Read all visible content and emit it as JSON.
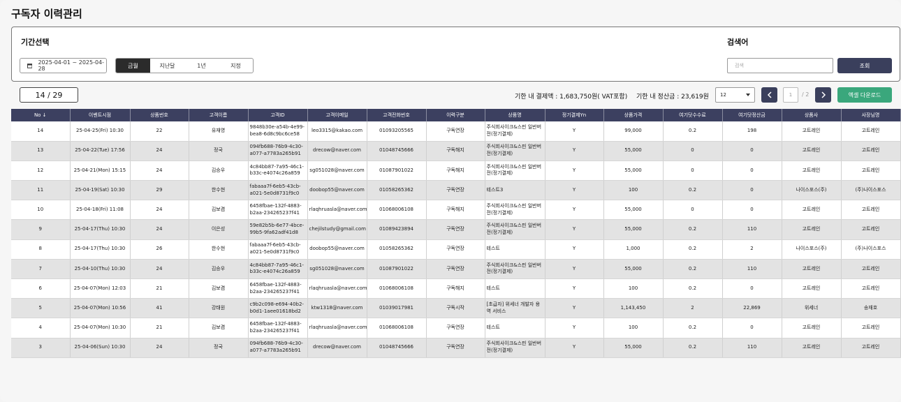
{
  "page_title": "구독자 이력관리",
  "filters": {
    "period_label": "기간선택",
    "search_label": "검색어",
    "date_range": "2025-04-01 ~ 2025-04-28",
    "period_tabs": [
      "금월",
      "지난달",
      "1년",
      "지정"
    ],
    "active_tab": "금월",
    "search_placeholder": "검색",
    "search_button": "조회"
  },
  "toolbar": {
    "page_count": "14 / 29",
    "payment_total": "기한 내 결제액 : 1,683,750원( VAT포함)",
    "settlement_total": "기한 내 정산금 : 23,619원",
    "page_size": "12",
    "current_page": "1",
    "total_pages": "/ 2",
    "excel_button": "엑셀 다운로드"
  },
  "colors": {
    "header_bg": "#3c4060",
    "nav_btn": "#3a3f5c",
    "excel_btn": "#3aa77c"
  },
  "table": {
    "columns": [
      "No ↓",
      "이벤트시점",
      "상품번호",
      "고객이름",
      "고객ID",
      "고객이메일",
      "고객전화번호",
      "이력구분",
      "상품명",
      "정기결제Yn",
      "상품가격",
      "여기닷수수료",
      "여기닷정산금",
      "상품사",
      "사장님명"
    ],
    "rows": [
      [
        "14",
        "25-04-25(Fri) 10:30",
        "22",
        "유재영",
        "9848b30e-a54b-4e99-bea8-6d8c9bc6ce58",
        "leo3315@kakao.com",
        "01093205565",
        "구독연장",
        "주식회사이크&스핀 일반버전(정기결제)",
        "Y",
        "99,000",
        "0.2",
        "198",
        "고트레인",
        "고트레인"
      ],
      [
        "13",
        "25-04-22(Tue) 17:56",
        "24",
        "정국",
        "094fb688-76b9-4c30-a077-a7783a265b91",
        "drecow@naver.com",
        "01048745666",
        "구독해지",
        "주식회사이크&스핀 일반버전(정기결제)",
        "Y",
        "55,000",
        "0",
        "0",
        "고트레인",
        "고트레인"
      ],
      [
        "12",
        "25-04-21(Mon) 15:15",
        "24",
        "김승우",
        "4c84bb87-7a95-46c1-b33c-e4074c26a859",
        "sg051028@naver.com",
        "01087901022",
        "구독해지",
        "주식회사이크&스핀 일반버전(정기결제)",
        "Y",
        "55,000",
        "0",
        "0",
        "고트레인",
        "고트레인"
      ],
      [
        "11",
        "25-04-19(Sat) 10:30",
        "29",
        "한수현",
        "fabaaa7f-6eb5-43cb-a021-5e0d8731f9c0",
        "doobop55@naver.com",
        "01058265362",
        "구독연장",
        "테스트3",
        "Y",
        "100",
        "0.2",
        "0",
        "나이스포스(주)",
        "(주)나이스포스"
      ],
      [
        "10",
        "25-04-18(Fri) 11:08",
        "24",
        "김보겸",
        "6458fbae-132f-4883-b2aa-234265237f41",
        "rlaqhruasla@naver.com",
        "01068006108",
        "구독해지",
        "주식회사이크&스핀 일반버전(정기결제)",
        "Y",
        "55,000",
        "0",
        "0",
        "고트레인",
        "고트레인"
      ],
      [
        "9",
        "25-04-17(Thu) 10:30",
        "24",
        "이은성",
        "59e82b5b-6e77-4bce-99b5-9fa62adf41d8",
        "chejilstudy@gmail.com",
        "01089423894",
        "구독연장",
        "주식회사이크&스핀 일반버전(정기결제)",
        "Y",
        "55,000",
        "0.2",
        "110",
        "고트레인",
        "고트레인"
      ],
      [
        "8",
        "25-04-17(Thu) 10:30",
        "26",
        "한수현",
        "fabaaa7f-6eb5-43cb-a021-5e0d8731f9c0",
        "doobop55@naver.com",
        "01058265362",
        "구독연장",
        "테스트",
        "Y",
        "1,000",
        "0.2",
        "2",
        "나이스포스(주)",
        "(주)나이스포스"
      ],
      [
        "7",
        "25-04-10(Thu) 10:30",
        "24",
        "김승우",
        "4c84bb87-7a95-46c1-b33c-e4074c26a859",
        "sg051028@naver.com",
        "01087901022",
        "구독연장",
        "주식회사이크&스핀 일반버전(정기결제)",
        "Y",
        "55,000",
        "0.2",
        "110",
        "고트레인",
        "고트레인"
      ],
      [
        "6",
        "25-04-07(Mon) 12:03",
        "21",
        "김보겸",
        "6458fbae-132f-4883-b2aa-234265237f41",
        "rlaqhruasla@naver.com",
        "01068006108",
        "구독해지",
        "테스트",
        "Y",
        "100",
        "0.2",
        "0",
        "고트레인",
        "고트레인"
      ],
      [
        "5",
        "25-04-07(Mon) 10:56",
        "41",
        "강태원",
        "c9b2c098-e694-40b2-b0d1-1aee01618bd2",
        "ktw1318@naver.com",
        "01039017981",
        "구독시작",
        "[초급자] 위세너 개발자 용역 서비스",
        "Y",
        "1,143,450",
        "2",
        "22,869",
        "위세너",
        "송재호"
      ],
      [
        "4",
        "25-04-07(Mon) 10:30",
        "21",
        "김보겸",
        "6458fbae-132f-4883-b2aa-234265237f41",
        "rlaqhruasla@naver.com",
        "01068006108",
        "구독연장",
        "테스트",
        "Y",
        "100",
        "0.2",
        "0",
        "고트레인",
        "고트레인"
      ],
      [
        "3",
        "25-04-06(Sun) 10:30",
        "24",
        "정국",
        "094fb688-76b9-4c30-a077-a7783a265b91",
        "drecow@naver.com",
        "01048745666",
        "구독연장",
        "주식회사이크&스핀 일반버전(정기결제)",
        "Y",
        "55,000",
        "0.2",
        "110",
        "고트레인",
        "고트레인"
      ]
    ]
  }
}
